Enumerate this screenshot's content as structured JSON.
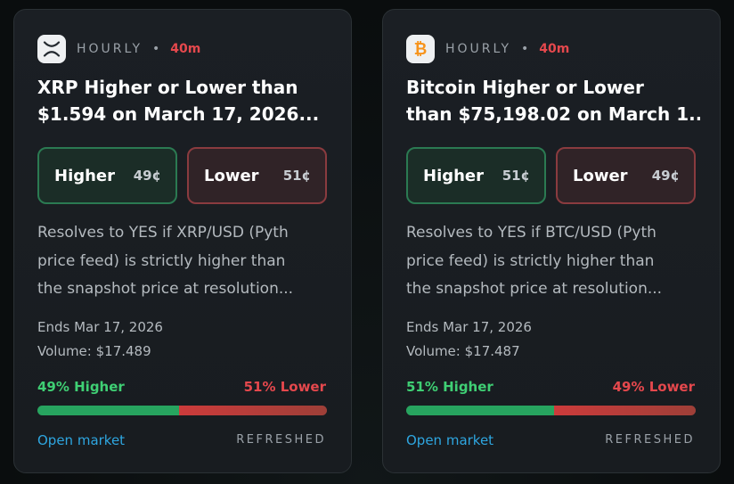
{
  "cards": [
    {
      "icon": "xrp-icon",
      "frequency": "HOURLY",
      "separator": "•",
      "time_left": "40m",
      "title": "XRP Higher or Lower than\n$1.594 on March 17, 2026...",
      "higher_label": "Higher",
      "higher_price": "49¢",
      "lower_label": "Lower",
      "lower_price": "51¢",
      "description": "Resolves to YES if XRP/USD (Pyth\nprice feed) is strictly higher than\nthe snapshot price at resolution...",
      "ends": "Ends Mar 17, 2026",
      "volume": "Volume: $17.489",
      "higher_pct_text": "49% Higher",
      "lower_pct_text": "51% Lower",
      "higher_share": 0.49,
      "open_label": "Open market",
      "status": "REFRESHED"
    },
    {
      "icon": "bitcoin-icon",
      "frequency": "HOURLY",
      "separator": "•",
      "time_left": "40m",
      "title": "Bitcoin Higher or Lower\nthan $75,198.02 on March 1...",
      "higher_label": "Higher",
      "higher_price": "51¢",
      "lower_label": "Lower",
      "lower_price": "49¢",
      "description": "Resolves to YES if BTC/USD (Pyth\nprice feed) is strictly higher than\nthe snapshot price at resolution...",
      "ends": "Ends Mar 17, 2026",
      "volume": "Volume: $17.487",
      "higher_pct_text": "51% Higher",
      "lower_pct_text": "49% Lower",
      "higher_share": 0.51,
      "open_label": "Open market",
      "status": "REFRESHED"
    }
  ],
  "colors": {
    "higher": "#3fcf74",
    "lower": "#e5484d",
    "link": "#2ea6e0",
    "bitcoin": "#f7931a"
  }
}
